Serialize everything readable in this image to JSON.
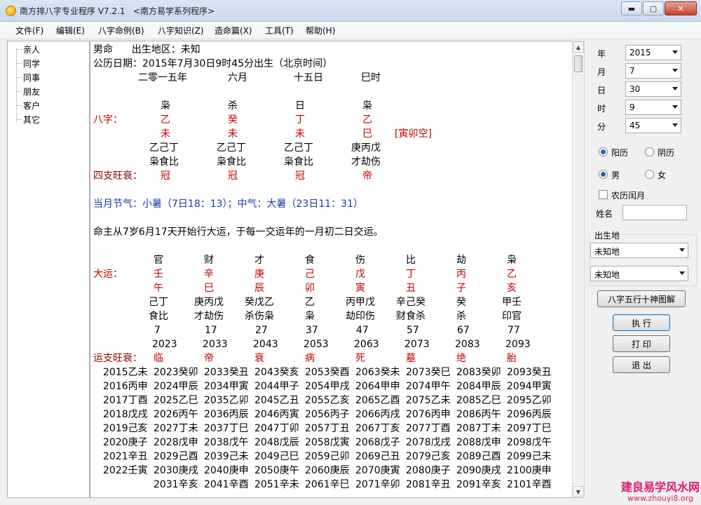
{
  "window": {
    "title": "南方排八字专业程序 V7.2.1   <南方易学系列程序>",
    "min": "▬",
    "max": "▢",
    "close": "✕"
  },
  "menu": [
    "文件(F)",
    "编辑(E)",
    "八字命例(B)",
    "八字知识(Z)",
    "造命篇(X)",
    "工具(T)",
    "帮助(H)"
  ],
  "tree": [
    "亲人",
    "同学",
    "同事",
    "朋友",
    "客户",
    "其它"
  ],
  "chart": {
    "header1": "男命      出生地区：未知",
    "header2": "公历日期：2015年7月30日9时45分出生（北京时间）",
    "pillar_dates": [
      "二零一五年",
      "六月",
      "十五日",
      "巳时"
    ],
    "gods": [
      "枭",
      "杀",
      "日",
      "枭"
    ],
    "bazi_label": "八字：",
    "stems": [
      "乙",
      "癸",
      "丁",
      "乙"
    ],
    "branches": [
      "未",
      "未",
      "未",
      "巳"
    ],
    "kongwang": "[寅卯空]",
    "hidden": [
      "乙己丁",
      "乙己丁",
      "乙己丁",
      "庚丙戊"
    ],
    "hidden_gods": [
      "枭食比",
      "枭食比",
      "枭食比",
      "才劫伤"
    ],
    "wangshuai_label": "四支旺衰：",
    "wangshuai": [
      "冠",
      "冠",
      "冠",
      "帝"
    ],
    "jieqi": "当月节气：小暑（7日18：13）；中气：大暑（23日11：31）",
    "luck_start": "命主从7岁6月17天开始行大运，于每一交运年的一月初二日交运。",
    "dayun_label": "大运：",
    "dayun_gods": [
      "官",
      "财",
      "才",
      "食",
      "伤",
      "比",
      "劫",
      "枭"
    ],
    "dayun_stems": [
      "壬",
      "辛",
      "庚",
      "己",
      "戊",
      "丁",
      "丙",
      "乙"
    ],
    "dayun_branches": [
      "午",
      "巳",
      "辰",
      "卯",
      "寅",
      "丑",
      "子",
      "亥"
    ],
    "dayun_hidden": [
      "己丁",
      "庚丙戊",
      "癸戊乙",
      "乙",
      "丙甲戊",
      "辛己癸",
      "癸",
      "甲壬"
    ],
    "dayun_hidden_gods": [
      "食比",
      "才劫伤",
      "杀伤枭",
      "枭",
      "劫印伤",
      "财食杀",
      "杀",
      "印官"
    ],
    "dayun_ages": [
      "7",
      "17",
      "27",
      "37",
      "47",
      "57",
      "67",
      "77"
    ],
    "dayun_years": [
      "2023",
      "2033",
      "2043",
      "2053",
      "2063",
      "2073",
      "2083",
      "2093"
    ],
    "yun_ws_label": "运支旺衰：",
    "yun_ws": [
      "临",
      "帝",
      "衰",
      "病",
      "死",
      "墓",
      "绝",
      "胎"
    ],
    "liunian": [
      [
        "2015乙未",
        "2023癸卯",
        "2033癸丑",
        "2043癸亥",
        "2053癸酉",
        "2063癸未",
        "2073癸巳",
        "2083癸卯",
        "2093癸丑"
      ],
      [
        "2016丙申",
        "2024甲辰",
        "2034甲寅",
        "2044甲子",
        "2054甲戌",
        "2064甲申",
        "2074甲午",
        "2084甲辰",
        "2094甲寅"
      ],
      [
        "2017丁酉",
        "2025乙巳",
        "2035乙卯",
        "2045乙丑",
        "2055乙亥",
        "2065乙酉",
        "2075乙未",
        "2085乙巳",
        "2095乙卯"
      ],
      [
        "2018戊戌",
        "2026丙午",
        "2036丙辰",
        "2046丙寅",
        "2056丙子",
        "2066丙戌",
        "2076丙申",
        "2086丙午",
        "2096丙辰"
      ],
      [
        "2019己亥",
        "2027丁未",
        "2037丁巳",
        "2047丁卯",
        "2057丁丑",
        "2067丁亥",
        "2077丁酉",
        "2087丁未",
        "2097丁巳"
      ],
      [
        "2020庚子",
        "2028戊申",
        "2038戊午",
        "2048戊辰",
        "2058戊寅",
        "2068戊子",
        "2078戊戌",
        "2088戊申",
        "2098戊午"
      ],
      [
        "2021辛丑",
        "2029己酉",
        "2039己未",
        "2049己巳",
        "2059己卯",
        "2069己丑",
        "2079己亥",
        "2089己酉",
        "2099己未"
      ],
      [
        "2022壬寅",
        "2030庚戌",
        "2040庚申",
        "2050庚午",
        "2060庚辰",
        "2070庚寅",
        "2080庚子",
        "2090庚戌",
        "2100庚申"
      ],
      [
        "",
        "2031辛亥",
        "2041辛酉",
        "2051辛未",
        "2061辛巳",
        "2071辛卯",
        "2081辛丑",
        "2091辛亥",
        "2101辛酉"
      ]
    ]
  },
  "form": {
    "year_label": "年",
    "year": "2015",
    "month_label": "月",
    "month": "7",
    "day_label": "日",
    "day": "30",
    "hour_label": "时",
    "hour": "9",
    "minute_label": "分",
    "minute": "45",
    "solar": "阳历",
    "lunar": "阴历",
    "male": "男",
    "female": "女",
    "leap": "农历闰月",
    "name_label": "姓名",
    "birthplace_label": "出生地",
    "place1": "未知地",
    "place2": "未知地",
    "diagram_btn": "八字五行十神图解",
    "run_btn": "执 行",
    "print_btn": "打 印",
    "exit_btn": "退 出"
  },
  "watermark": {
    "line1": "建良易学风水网",
    "line2": "www.zhouyi8.org"
  }
}
